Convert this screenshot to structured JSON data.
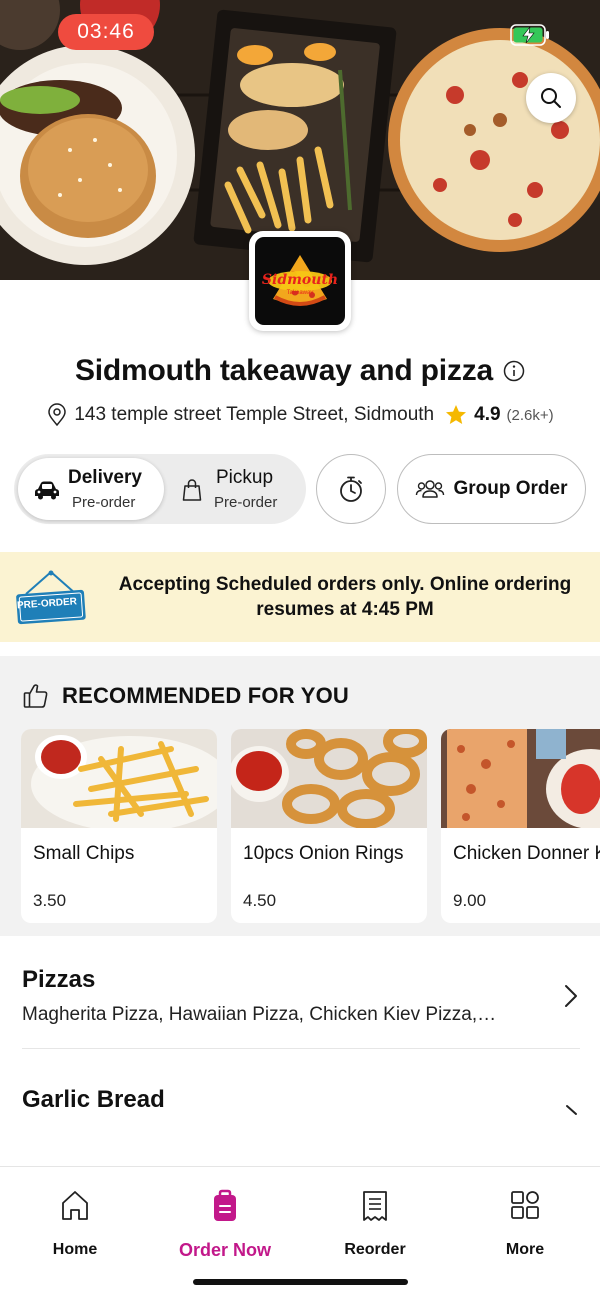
{
  "status_bar": {
    "time": "03:46"
  },
  "restaurant": {
    "name": "Sidmouth takeaway and pizza",
    "address": "143 temple street Temple Street, Sidmouth",
    "rating": "4.9",
    "reviews": "(2.6k+)",
    "logo_text": "Sidmouth",
    "logo_subtext": "Takeaway"
  },
  "order_modes": {
    "delivery": {
      "label": "Delivery",
      "sub": "Pre-order",
      "selected": true
    },
    "pickup": {
      "label": "Pickup",
      "sub": "Pre-order",
      "selected": false
    }
  },
  "group_order_label": "Group Order",
  "banner": {
    "tag": "PRE-ORDER",
    "message": "Accepting Scheduled orders only. Online ordering resumes at 4:45 PM"
  },
  "recommended": {
    "heading": "RECOMMENDED FOR YOU",
    "items": [
      {
        "name": "Small Chips",
        "price": "3.50"
      },
      {
        "name": "10pcs Onion Rings",
        "price": "4.50"
      },
      {
        "name": "Chicken Donner Kebab",
        "price": "9.00"
      }
    ]
  },
  "categories": [
    {
      "title": "Pizzas",
      "items": "Magherita Pizza, Hawaiian Pizza, Chicken Kiev Pizza,…"
    },
    {
      "title": "Garlic Bread",
      "items": ""
    }
  ],
  "bottom_nav": [
    {
      "label": "Home",
      "icon": "home-icon",
      "active": false
    },
    {
      "label": "Order Now",
      "icon": "order-bag-icon",
      "active": true
    },
    {
      "label": "Reorder",
      "icon": "receipt-icon",
      "active": false
    },
    {
      "label": "More",
      "icon": "grid-icon",
      "active": false
    }
  ],
  "colors": {
    "accent": "#c2188a",
    "status_time_bg": "#ef4b3f",
    "banner_bg": "#fbf3d2",
    "star": "#f5b800",
    "preorder_tag": "#1f7fb8"
  }
}
